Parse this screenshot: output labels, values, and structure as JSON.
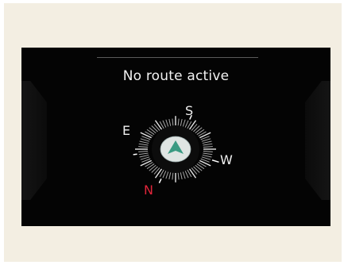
{
  "display": {
    "status_text": "No route active"
  },
  "compass": {
    "labels": {
      "south": "S",
      "east": "E",
      "west": "W",
      "north": "N"
    },
    "north_color": "#e0253a",
    "arrow_color": "#3a9a82",
    "arrow_icon": "navigation-arrow-icon"
  },
  "colors": {
    "screen_background": "#040404",
    "frame_background": "#f3eee2",
    "text": "#f2f2f2"
  }
}
